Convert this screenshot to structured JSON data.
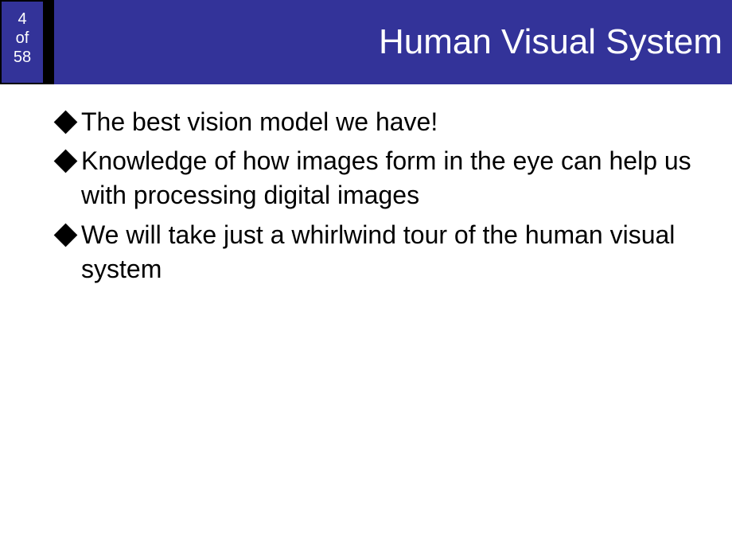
{
  "header": {
    "pageCurrent": "4",
    "pageOf": "of",
    "pageTotal": "58",
    "title": "Human Visual System"
  },
  "bullets": [
    {
      "text": "The best vision model we have!"
    },
    {
      "text": "Knowledge of how images form in the eye can help us with processing digital images"
    },
    {
      "text": "We will take just a whirlwind tour of the human visual system"
    }
  ]
}
